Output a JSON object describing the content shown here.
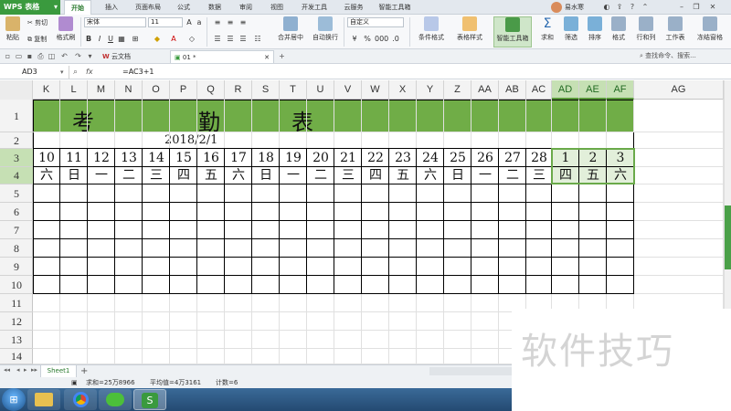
{
  "titlebar": {
    "app_button": "WPS 表格",
    "menu_tabs": [
      "开始",
      "插入",
      "页面布局",
      "公式",
      "数据",
      "审阅",
      "视图",
      "开发工具",
      "云服务",
      "智能工具箱"
    ],
    "active_tab": "开始",
    "user_name": "易水寒"
  },
  "ribbon": {
    "paste": "粘贴",
    "cut": "剪切",
    "copy": "复制",
    "format_painter": "格式刷",
    "font_name": "宋体",
    "font_size": "11",
    "number_format": "自定义",
    "merge_center": "合并居中",
    "wrap_text": "自动换行",
    "cond_format": "条件格式",
    "table_style": "表格样式",
    "smart_tools": "智能工具箱",
    "sum": "求和",
    "filter": "筛选",
    "sort": "排序",
    "format": "格式",
    "row_col": "行和列",
    "worksheet": "工作表",
    "freeze": "冻结窗格"
  },
  "filetabs": {
    "cloud_docs": "云文档",
    "current_file": "01 *",
    "search_command": "查找命令、搜索..."
  },
  "formula": {
    "cell_ref": "AD3",
    "fx_label": "fx",
    "formula_text": "=AC3+1"
  },
  "columns": [
    "K",
    "L",
    "M",
    "N",
    "O",
    "P",
    "Q",
    "R",
    "S",
    "T",
    "U",
    "V",
    "W",
    "X",
    "Y",
    "Z",
    "AA",
    "AB",
    "AC",
    "AD",
    "AE",
    "AF",
    "AG"
  ],
  "rows": [
    "1",
    "2",
    "3",
    "4",
    "5",
    "6",
    "7",
    "8",
    "9",
    "10",
    "11",
    "12",
    "13",
    "14"
  ],
  "sheet": {
    "title_chars": [
      "考",
      "勤",
      "表"
    ],
    "date": "2018/2/1",
    "days": [
      "10",
      "11",
      "12",
      "13",
      "14",
      "15",
      "16",
      "17",
      "18",
      "19",
      "20",
      "21",
      "22",
      "23",
      "24",
      "25",
      "26",
      "27",
      "28",
      "1",
      "2",
      "3"
    ],
    "weekdays": [
      "六",
      "日",
      "一",
      "二",
      "三",
      "四",
      "五",
      "六",
      "日",
      "一",
      "二",
      "三",
      "四",
      "五",
      "六",
      "日",
      "一",
      "二",
      "三",
      "四",
      "五",
      "六"
    ],
    "accent_green": "#70ad47",
    "selection_green": "#e2efda"
  },
  "sheettabs": {
    "sheet_name": "Sheet1",
    "add": "+"
  },
  "status": {
    "sum": "求和=25万8966",
    "average": "平均值=4万3161",
    "count": "计数=6"
  },
  "watermark": "软件技巧"
}
